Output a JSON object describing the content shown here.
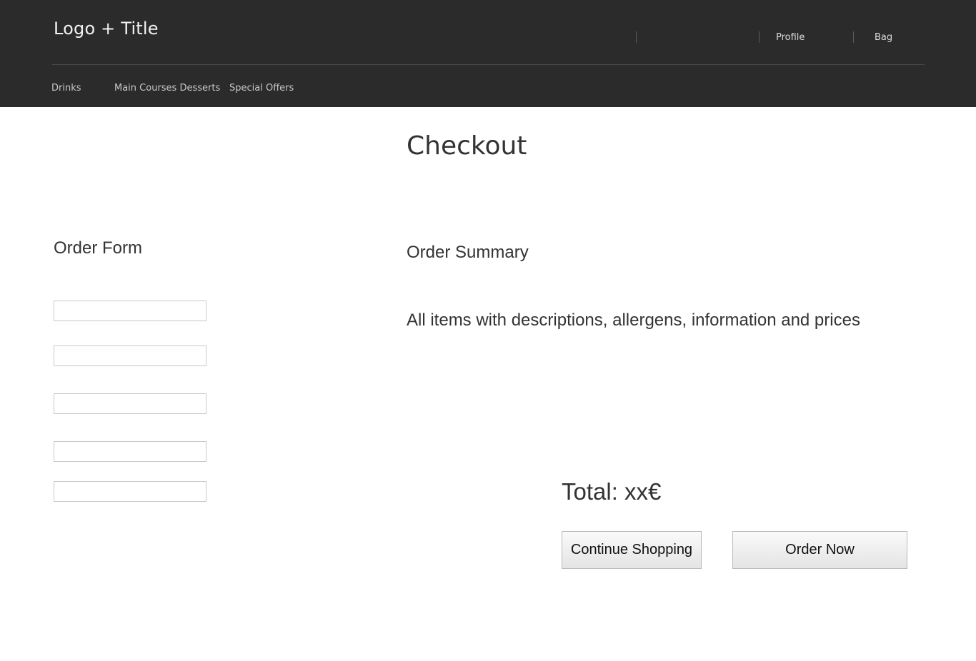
{
  "header": {
    "title": "Logo + Title",
    "utility_links": [
      {
        "label": "Profile"
      },
      {
        "label": "Bag"
      }
    ],
    "nav": [
      {
        "label": "Drinks"
      },
      {
        "label": "Main Courses Desserts"
      },
      {
        "label": "Special Offers"
      }
    ]
  },
  "page": {
    "heading": "Checkout"
  },
  "order_form": {
    "heading": "Order Form",
    "fields": [
      {
        "value": "",
        "placeholder": ""
      },
      {
        "value": "",
        "placeholder": ""
      },
      {
        "value": "",
        "placeholder": ""
      },
      {
        "value": "",
        "placeholder": ""
      },
      {
        "value": "",
        "placeholder": ""
      }
    ]
  },
  "order_summary": {
    "heading": "Order Summary",
    "items_text": "All items with descriptions, allergens, information and prices",
    "total": "Total: xx€"
  },
  "actions": {
    "continue_label": "Continue Shopping",
    "order_label": "Order Now"
  },
  "colors": {
    "header_background": "#2b2b2b",
    "page_background": "#ffffff",
    "text": "#333333"
  }
}
